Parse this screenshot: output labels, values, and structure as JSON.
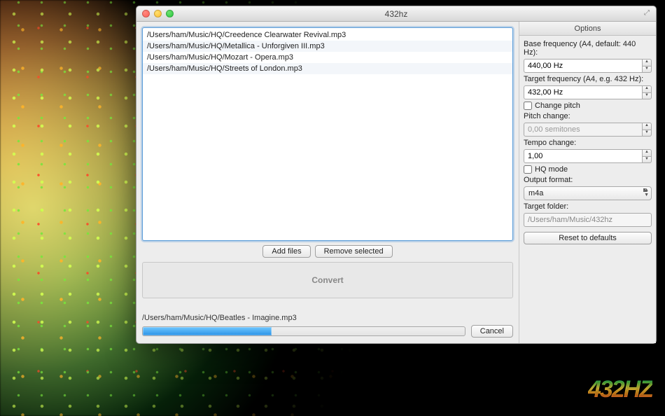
{
  "window": {
    "title": "432hz",
    "maximize_icon": "⤢"
  },
  "files": [
    "/Users/ham/Music/HQ/Creedence Clearwater Revival.mp3",
    "/Users/ham/Music/HQ/Metallica - Unforgiven III.mp3",
    "/Users/ham/Music/HQ/Mozart - Opera.mp3",
    "/Users/ham/Music/HQ/Streets of London.mp3"
  ],
  "buttons": {
    "add_files": "Add files",
    "remove_selected": "Remove selected",
    "convert": "Convert",
    "cancel": "Cancel",
    "reset": "Reset to defaults"
  },
  "progress": {
    "current_file": "/Users/ham/Music/HQ/Beatles - Imagine.mp3",
    "percent": 40
  },
  "options": {
    "header": "Options",
    "base_freq_label": "Base frequency (A4, default: 440 Hz):",
    "base_freq_value": "440,00 Hz",
    "target_freq_label": "Target frequency (A4, e.g. 432 Hz):",
    "target_freq_value": "432,00 Hz",
    "change_pitch_label": "Change pitch",
    "change_pitch_checked": false,
    "pitch_change_label": "Pitch change:",
    "pitch_change_value": "0,00 semitones",
    "tempo_change_label": "Tempo change:",
    "tempo_change_value": "1,00",
    "hq_mode_label": "HQ mode",
    "hq_mode_checked": false,
    "output_format_label": "Output format:",
    "output_format_value": "m4a",
    "target_folder_label": "Target folder:",
    "target_folder_value": "/Users/ham/Music/432hz"
  },
  "logo": "432HZ"
}
